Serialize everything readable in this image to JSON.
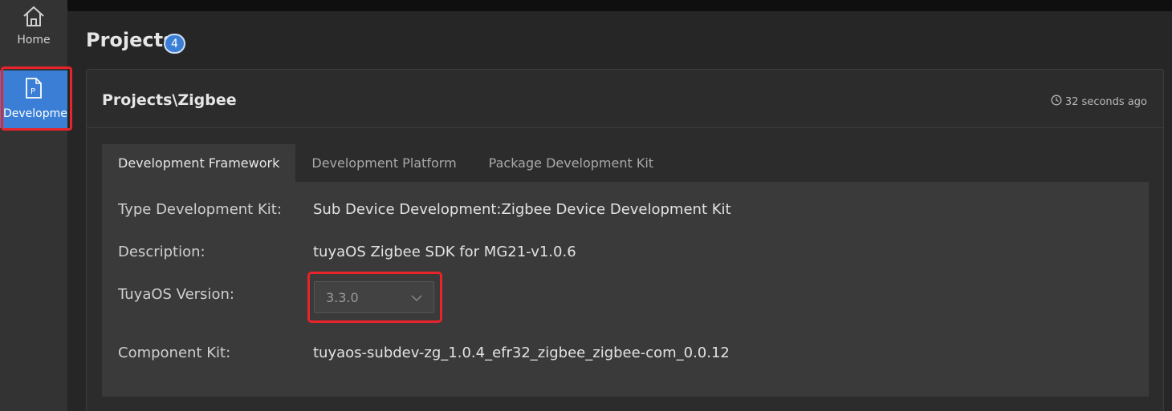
{
  "sidebar": {
    "items": [
      {
        "label": "Home",
        "icon": "home-icon"
      },
      {
        "label": "Development",
        "icon": "project-file-icon",
        "active": true
      }
    ]
  },
  "page": {
    "title": "Projects",
    "count": "4"
  },
  "card": {
    "title": "Projects\\Zigbee",
    "time": "32 seconds ago"
  },
  "tabs": [
    "Development Framework",
    "Development Platform",
    "Package Development Kit"
  ],
  "fields": {
    "type_label": "Type Development Kit:",
    "type_value": "Sub Device Development:Zigbee Device Development Kit",
    "desc_label": "Description:",
    "desc_value": "tuyaOS Zigbee SDK for MG21-v1.0.6",
    "version_label": "TuyaOS Version:",
    "version_value": "3.3.0",
    "component_label": "Component Kit:",
    "component_value": "tuyaos-subdev-zg_1.0.4_efr32_zigbee_zigbee-com_0.0.12"
  },
  "colors": {
    "accent": "#3a7fd5",
    "highlight": "#e8232a"
  }
}
